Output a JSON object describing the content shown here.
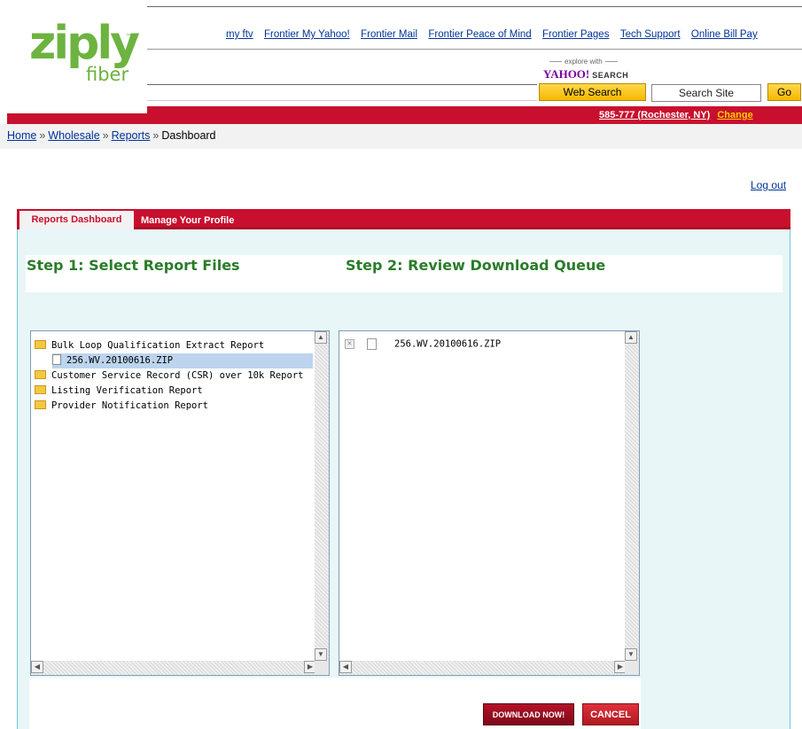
{
  "logo": {
    "word": "ziply",
    "sub": "fiber",
    "tm": "™"
  },
  "top_nav": {
    "links": [
      "my ftv",
      "Frontier My Yahoo!",
      "Frontier Mail",
      "Frontier Peace of Mind",
      "Frontier Pages",
      "Tech Support",
      "Online Bill Pay"
    ]
  },
  "search": {
    "explore_text": "explore with",
    "yahoo_brand": "YAHOO!",
    "yahoo_search_word": "SEARCH",
    "query_value": "",
    "web_search_label": "Web Search",
    "search_site_label": "Search Site",
    "go_label": "Go"
  },
  "location": {
    "text": "585-777 (Rochester, NY)",
    "change_label": "Change"
  },
  "breadcrumb": {
    "home": "Home",
    "wholesale": "Wholesale",
    "reports": "Reports",
    "current": "Dashboard",
    "separator": "»"
  },
  "logout_label": "Log out",
  "tabs": {
    "active": "Reports Dashboard",
    "profile": "Manage Your Profile"
  },
  "steps": {
    "step1": "Step 1: Select Report Files",
    "step2": "Step 2: Review Download Queue"
  },
  "report_tree": [
    {
      "type": "folder",
      "label": "Bulk Loop Qualification Extract Report"
    },
    {
      "type": "file",
      "label": "256.WV.20100616.ZIP",
      "selected": true
    },
    {
      "type": "folder",
      "label": "Customer Service Record (CSR) over 10k Report"
    },
    {
      "type": "folder",
      "label": "Listing Verification Report"
    },
    {
      "type": "folder",
      "label": "Provider Notification Report"
    }
  ],
  "download_queue": [
    {
      "file": "256.WV.20100616.ZIP"
    }
  ],
  "buttons": {
    "download": "DOWNLOAD NOW!",
    "cancel": "CANCEL"
  },
  "colors": {
    "brand_green": "#6cb33f",
    "brand_red": "#c8102e",
    "step_green": "#2a7d2a",
    "link_blue": "#003399"
  }
}
